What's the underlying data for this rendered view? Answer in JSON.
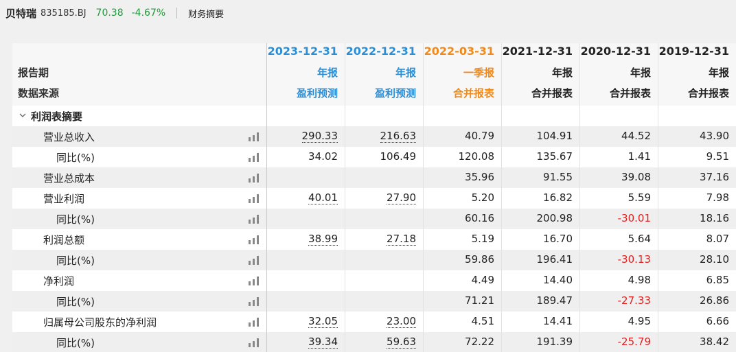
{
  "header": {
    "stock_name": "贝特瑞",
    "stock_code": "835185.BJ",
    "price": "70.38",
    "change": "-4.67%",
    "section": "财务摘要"
  },
  "table": {
    "label_period": "报告期",
    "label_source": "数据来源",
    "columns": [
      {
        "date": "2023-12-31",
        "type": "年报",
        "source": "盈利预测",
        "color": "#2c8fd6"
      },
      {
        "date": "2022-12-31",
        "type": "年报",
        "source": "盈利预测",
        "color": "#2c8fd6"
      },
      {
        "date": "2022-03-31",
        "type": "一季报",
        "source": "合并报表",
        "color": "#f08a1c"
      },
      {
        "date": "2021-12-31",
        "type": "年报",
        "source": "合并报表",
        "color": "#222222"
      },
      {
        "date": "2020-12-31",
        "type": "年报",
        "source": "合并报表",
        "color": "#222222"
      },
      {
        "date": "2019-12-31",
        "type": "年报",
        "source": "合并报表",
        "color": "#222222"
      }
    ],
    "group_label": "利润表摘要",
    "rows": [
      {
        "label": "营业总收入",
        "indent": 1,
        "values": [
          "290.33",
          "216.63",
          "40.79",
          "104.91",
          "44.52",
          "43.90"
        ]
      },
      {
        "label": "同比(%)",
        "indent": 2,
        "values": [
          "34.02",
          "106.49",
          "120.08",
          "135.67",
          "1.41",
          "9.51"
        ]
      },
      {
        "label": "营业总成本",
        "indent": 1,
        "values": [
          "",
          "",
          "35.96",
          "91.55",
          "39.08",
          "37.16"
        ]
      },
      {
        "label": "营业利润",
        "indent": 1,
        "values": [
          "40.01",
          "27.90",
          "5.20",
          "16.82",
          "5.59",
          "7.98"
        ]
      },
      {
        "label": "同比(%)",
        "indent": 2,
        "values": [
          "",
          "",
          "60.16",
          "200.98",
          "-30.01",
          "18.16"
        ]
      },
      {
        "label": "利润总额",
        "indent": 1,
        "values": [
          "38.99",
          "27.18",
          "5.19",
          "16.70",
          "5.64",
          "8.07"
        ]
      },
      {
        "label": "同比(%)",
        "indent": 2,
        "values": [
          "",
          "",
          "59.86",
          "196.41",
          "-30.13",
          "28.10"
        ]
      },
      {
        "label": "净利润",
        "indent": 1,
        "values": [
          "",
          "",
          "4.49",
          "14.40",
          "4.98",
          "6.85"
        ]
      },
      {
        "label": "同比(%)",
        "indent": 2,
        "values": [
          "",
          "",
          "71.21",
          "189.47",
          "-27.33",
          "26.86"
        ]
      },
      {
        "label": "归属母公司股东的净利润",
        "indent": 1,
        "values": [
          "32.05",
          "23.00",
          "4.51",
          "14.41",
          "4.95",
          "6.66"
        ]
      },
      {
        "label": "同比(%)",
        "indent": 2,
        "values": [
          "39.34",
          "59.63",
          "72.22",
          "191.39",
          "-25.79",
          "38.42"
        ]
      }
    ]
  },
  "colors": {
    "positive_green": "#1e9b3a",
    "negative_red": "#e02020",
    "forecast_blue": "#2c8fd6",
    "quarter_orange": "#f08a1c"
  }
}
